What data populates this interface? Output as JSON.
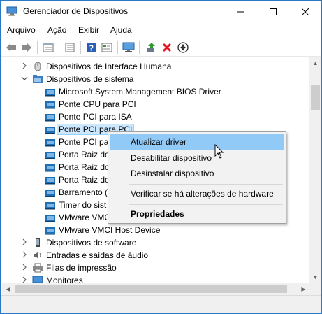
{
  "window": {
    "title": "Gerenciador de Dispositivos",
    "minimize_glyph": "—",
    "maximize_glyph": "☐",
    "close_glyph": "✕"
  },
  "menu": [
    "Arquivo",
    "Ação",
    "Exibir",
    "Ajuda"
  ],
  "toolbar": {
    "buttons": [
      {
        "name": "back-arrow-icon"
      },
      {
        "name": "forward-arrow-icon"
      },
      {
        "name": "properties-view-icon"
      },
      {
        "name": "list-view-icon"
      },
      {
        "name": "help-icon"
      },
      {
        "name": "details-view-icon"
      },
      {
        "name": "monitor-scan-icon"
      },
      {
        "name": "update-driver-icon"
      },
      {
        "name": "uninstall-red-x-icon"
      },
      {
        "name": "download-circle-icon"
      }
    ]
  },
  "tree": {
    "items": [
      {
        "label": "Dispositivos de Interface Humana",
        "level": 0,
        "expanded": false,
        "icon": "hid-icon"
      },
      {
        "label": "Dispositivos de sistema",
        "level": 0,
        "expanded": true,
        "icon": "system-devices-folder-icon"
      },
      {
        "label": "Microsoft System Management BIOS Driver",
        "level": 1,
        "icon": "system-device-icon"
      },
      {
        "label": "Ponte CPU para PCI",
        "level": 1,
        "icon": "system-device-icon"
      },
      {
        "label": "Ponte PCI para ISA",
        "level": 1,
        "icon": "system-device-icon"
      },
      {
        "label": "Ponte PCI para PCI",
        "level": 1,
        "icon": "system-device-icon",
        "selected": true
      },
      {
        "label": "Ponte PCI pa",
        "level": 1,
        "icon": "system-device-icon"
      },
      {
        "label": "Porta Raiz do",
        "level": 1,
        "icon": "system-device-icon"
      },
      {
        "label": "Porta Raiz do",
        "level": 1,
        "icon": "system-device-icon"
      },
      {
        "label": "Porta Raiz do",
        "level": 1,
        "icon": "system-device-icon"
      },
      {
        "label": "Barramento (",
        "level": 1,
        "icon": "system-device-icon"
      },
      {
        "label": "Timer do sist",
        "level": 1,
        "icon": "system-device-icon"
      },
      {
        "label": "VMware VMCI",
        "level": 1,
        "icon": "system-device-icon"
      },
      {
        "label": "VMware VMCI Host Device",
        "level": 1,
        "icon": "system-device-icon"
      },
      {
        "label": "Dispositivos de software",
        "level": 0,
        "expanded": false,
        "icon": "software-device-icon"
      },
      {
        "label": "Entradas e saídas de áudio",
        "level": 0,
        "expanded": false,
        "icon": "speaker-icon"
      },
      {
        "label": "Filas de impressão",
        "level": 0,
        "expanded": false,
        "icon": "printer-icon"
      },
      {
        "label": "Monitores",
        "level": 0,
        "expanded": false,
        "icon": "monitor-icon"
      }
    ]
  },
  "context_menu": {
    "items": [
      {
        "label": "Atualizar driver",
        "highlighted": true
      },
      {
        "label": "Desabilitar dispositivo"
      },
      {
        "label": "Desinstalar dispositivo"
      },
      {
        "separator": true
      },
      {
        "label": "Verificar se há alterações de hardware"
      },
      {
        "separator": true
      },
      {
        "label": "Propriedades",
        "bold": true
      }
    ]
  },
  "colors": {
    "accent_border": "#2b78c5",
    "selection_bg": "#cce8ff",
    "menu_highlight": "#91c9f7",
    "device_icon": "#1f6fb5",
    "red_x": "#e81123",
    "green_arrow": "#2e9b2e"
  }
}
